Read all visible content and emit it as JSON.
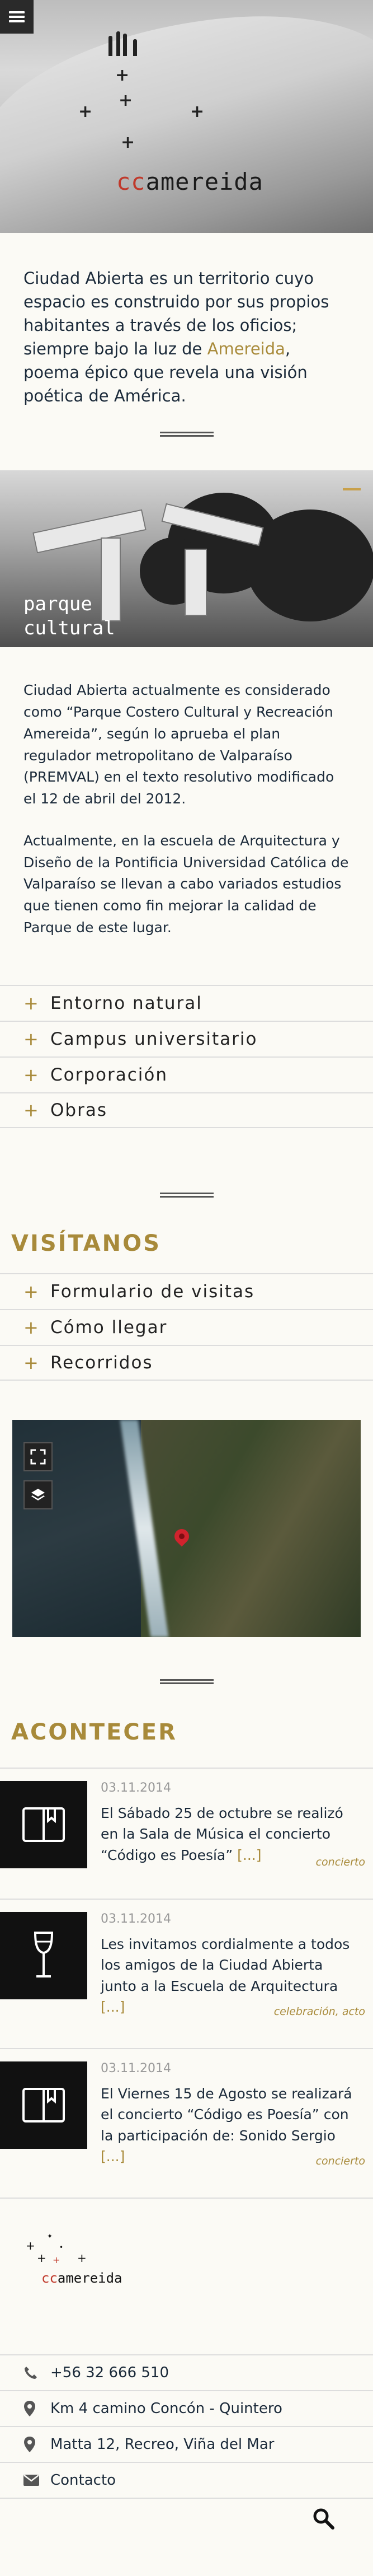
{
  "hero": {
    "logo_cc": "cc",
    "logo_rest": "amereida"
  },
  "intro": {
    "text_before": "Ciudad Abierta es un territorio cuyo espacio es construido por sus propios habitantes a través de los oficios; siempre bajo la luz de ",
    "accent": "Amereida",
    "text_after": ", poema épico que revela una visión poética de América."
  },
  "parque": {
    "title_line1": "parque",
    "title_line2": "cultural",
    "paragraph1": "Ciudad Abierta actualmente es considerado como “Parque Costero Cultural y Recreación Amereida”, según lo aprueba el plan regulador metropolitano de Valparaíso (PREMVAL) en el texto resolutivo modificado el 12 de abril del 2012.",
    "paragraph2": "Actualmente, en la escuela de Arquitectura y Diseño de la Pontificia Universidad Católica de Valparaíso se llevan a cabo variados estudios que tienen como fin mejorar la calidad de Parque de este lugar."
  },
  "accordion1": [
    {
      "label": "Entorno natural"
    },
    {
      "label": "Campus universitario"
    },
    {
      "label": "Corporación"
    },
    {
      "label": "Obras"
    }
  ],
  "visitanos": {
    "heading": "VISÍTANOS",
    "items": [
      {
        "label": "Formulario de visitas"
      },
      {
        "label": "Cómo llegar"
      },
      {
        "label": "Recorridos"
      }
    ]
  },
  "acontecer": {
    "heading": "ACONTECER",
    "events": [
      {
        "date": "03.11.2014",
        "text": "El Sábado 25 de octubre se realizó en la Sala de Música el concierto “Código es Poesía” ",
        "more": "[...]",
        "tag": "concierto",
        "icon": "book-icon"
      },
      {
        "date": "03.11.2014",
        "text": "Les invitamos cordialmente a todos los amigos de la Ciudad Abierta junto a la Escuela de Arquitectura ",
        "more": "[...]",
        "tag": "celebración, acto",
        "icon": "wine-glass-icon"
      },
      {
        "date": "03.11.2014",
        "text": "El Viernes 15 de Agosto se realizará el concierto “Código es Poesía” con la participación de: Sonido Sergio ",
        "more": "[...]",
        "tag": "concierto",
        "icon": "book-icon"
      }
    ]
  },
  "footer": {
    "logo_cc": "cc",
    "logo_rest": "amereida",
    "phone": "+56 32 666 510",
    "address1": "Km 4 camino Concón - Quintero",
    "address2": "Matta 12, Recreo, Viña del Mar",
    "contact": "Contacto"
  },
  "colors": {
    "accent": "#a88a3a",
    "logo_red": "#c0392b",
    "background": "#fbfaf5"
  }
}
